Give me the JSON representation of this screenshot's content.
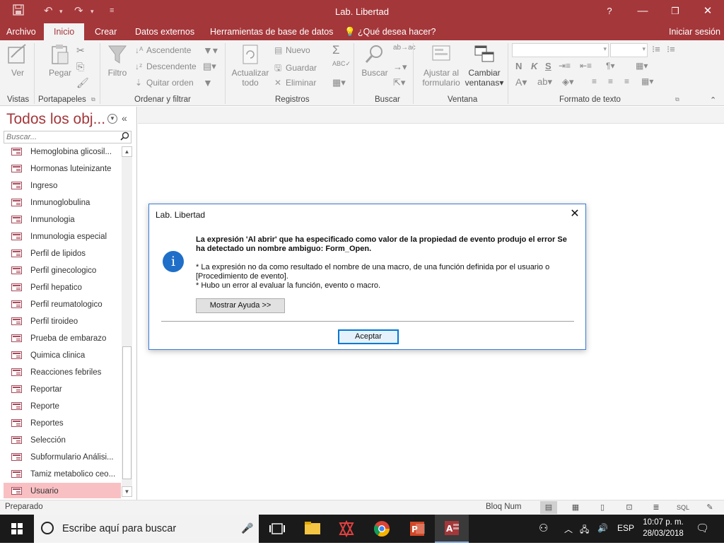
{
  "titlebar": {
    "title": "Lab. Libertad",
    "minimize": "?",
    "restore_label": "❐",
    "close_label": "✕"
  },
  "menubar": {
    "file_tab": "Archivo",
    "tabs": [
      "Inicio",
      "Crear",
      "Datos externos",
      "Herramientas de base de datos"
    ],
    "tell_me": "¿Qué desea hacer?",
    "sign_in": "Iniciar sesión"
  },
  "ribbon": {
    "groups": {
      "vistas": "Vistas",
      "portapapeles": "Portapapeles",
      "ordenar": "Ordenar y filtrar",
      "registros": "Registros",
      "buscar": "Buscar",
      "ventana": "Ventana",
      "formato": "Formato de texto"
    },
    "buttons": {
      "ver": "Ver",
      "pegar": "Pegar",
      "filtro": "Filtro",
      "ascendente": "Ascendente",
      "descendente": "Descendente",
      "quitar_orden": "Quitar orden",
      "actualizar_1": "Actualizar",
      "actualizar_2": "todo",
      "nuevo": "Nuevo",
      "guardar": "Guardar",
      "eliminar": "Eliminar",
      "buscar": "Buscar",
      "ajustar_1": "Ajustar al",
      "ajustar_2": "formulario",
      "cambiar_1": "Cambiar",
      "cambiar_2": "ventanas",
      "bold": "N",
      "italic": "K",
      "underline": "S"
    }
  },
  "navpane": {
    "header": "Todos los obj...",
    "search_placeholder": "Buscar...",
    "items": [
      "Hemoglobina glicosil...",
      "Hormonas luteinizante",
      "Ingreso",
      "Inmunoglobulina",
      "Inmunologia",
      "Inmunologia especial",
      "Perfil de lipidos",
      "Perfil ginecologico",
      "Perfil hepatico",
      "Perfil reumatologico",
      "Perfil tiroideo",
      "Prueba de embarazo",
      "Quimica clinica",
      "Reacciones febriles",
      "Reportar",
      "Reporte",
      "Reportes",
      "Selección",
      "Subformulario Análisi...",
      "Tamiz metabolico ceo...",
      "Usuario"
    ],
    "selected_index": 20
  },
  "dialog": {
    "title": "Lab. Libertad",
    "message_bold": "La expresión 'Al abrir' que ha especificado como valor de la propiedad de evento produjo el error Se ha detectado un nombre ambiguo: Form_Open.",
    "detail_1": "* La expresión no da como resultado el nombre de una macro, de una función definida por el usuario o [Procedimiento de evento].",
    "detail_2": "* Hubo un error al evaluar la función, evento o macro.",
    "help_button": "Mostrar Ayuda >>",
    "ok_button": "Aceptar"
  },
  "statusbar": {
    "status": "Preparado",
    "bloq": "Bloq Num",
    "sql": "SQL"
  },
  "taskbar": {
    "search_placeholder": "Escribe aquí para buscar",
    "lang": "ESP",
    "time": "10:07 p. m.",
    "date": "28/03/2018"
  },
  "colors": {
    "accent": "#a4373a",
    "selected_item": "#f9c0c3",
    "dialog_border": "#3a7bd5",
    "info_icon": "#1f6fc8"
  }
}
